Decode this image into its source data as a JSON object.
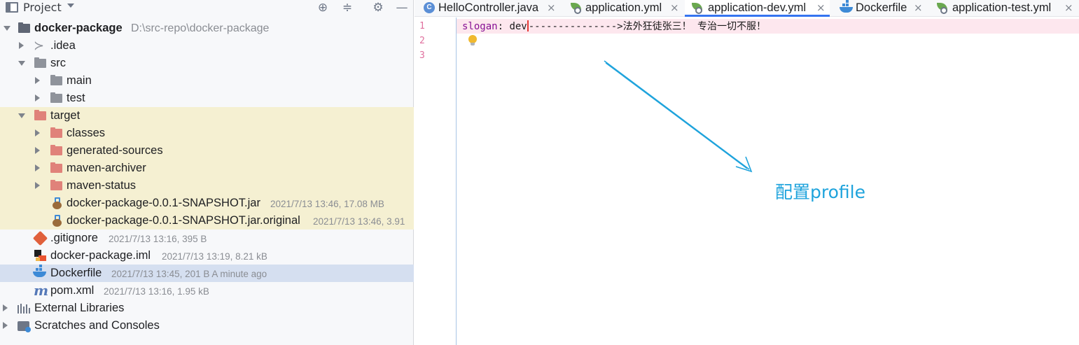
{
  "panel": {
    "title": "Project",
    "tool_icons": [
      "crosshair-icon",
      "collapse-icon",
      "gear-icon",
      "minimize-icon"
    ]
  },
  "tree": {
    "root": {
      "name": "docker-package",
      "path": "D:\\src-repo\\docker-package"
    },
    "idea": ".idea",
    "src": "src",
    "main": "main",
    "test": "test",
    "target": "target",
    "classes": "classes",
    "generated_sources": "generated-sources",
    "maven_archiver": "maven-archiver",
    "maven_status": "maven-status",
    "jar": {
      "name": "docker-package-0.0.1-SNAPSHOT.jar",
      "meta": "2021/7/13 13:46, 17.08 MB"
    },
    "jar_original": {
      "name": "docker-package-0.0.1-SNAPSHOT.jar.original",
      "meta": "2021/7/13 13:46, 3.91"
    },
    "gitignore": {
      "name": ".gitignore",
      "meta": "2021/7/13 13:16, 395 B"
    },
    "iml": {
      "name": "docker-package.iml",
      "meta": "2021/7/13 13:19, 8.21 kB"
    },
    "dockerfile": {
      "name": "Dockerfile",
      "meta": "2021/7/13 13:45, 201 B  A minute ago"
    },
    "pom": {
      "name": "pom.xml",
      "meta": "2021/7/13 13:16, 1.95 kB"
    },
    "external_libraries": "External Libraries",
    "scratches": "Scratches and Consoles"
  },
  "tabs": [
    {
      "label": "HelloController.java",
      "close": "×"
    },
    {
      "label": "application.yml",
      "close": "×"
    },
    {
      "label": "application-dev.yml",
      "close": "×"
    },
    {
      "label": "Dockerfile",
      "close": "×"
    },
    {
      "label": "application-test.yml",
      "close": "×"
    }
  ],
  "editor": {
    "line_numbers": [
      "1",
      "2",
      "3"
    ],
    "key": "slogan",
    "sep": ": ",
    "value": "dev",
    "rest": "--------------->法外狂徒张三！ 专治一切不服！"
  },
  "annotation": "配置profile",
  "colors": {
    "accent": "#3574f0",
    "target_highlight": "#f5f0d2",
    "selected_row": "#d5dff0",
    "annotation": "#1ea3dc",
    "yaml_key": "#871094"
  }
}
